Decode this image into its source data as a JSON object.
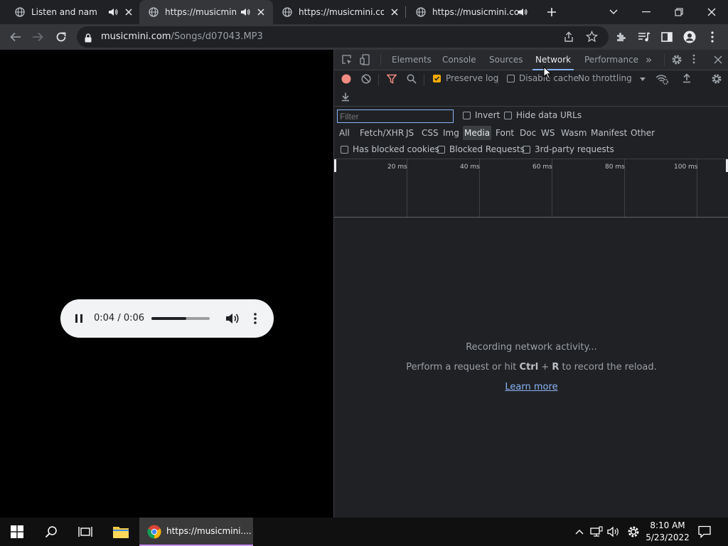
{
  "browser": {
    "tabs": [
      {
        "title": "Listen and name th",
        "audio": true
      },
      {
        "title": "https://musicmini.c",
        "audio": true
      },
      {
        "title": "https://musicmini.com/",
        "audio": false
      },
      {
        "title": "https://musicmini.com/",
        "audio": true
      }
    ],
    "new_tab_label": "+",
    "url_host": "musicmini.com",
    "url_path": "/Songs/d07043.MP3"
  },
  "player": {
    "time_display": "0:04 / 0:06",
    "progress_fraction": 0.6
  },
  "devtools": {
    "tabs": [
      "Elements",
      "Console",
      "Sources",
      "Network",
      "Performance"
    ],
    "active_tab": "Network",
    "more_tabs": "»",
    "toolbar": {
      "preserve_log": "Preserve log",
      "preserve_log_checked": true,
      "disable_cache": "Disable cache",
      "disable_cache_checked": false,
      "throttling": "No throttling"
    },
    "filter": {
      "placeholder": "Filter",
      "invert": "Invert",
      "hide_data_urls": "Hide data URLs",
      "types": [
        "All",
        "Fetch/XHR",
        "JS",
        "CSS",
        "Img",
        "Media",
        "Font",
        "Doc",
        "WS",
        "Wasm",
        "Manifest",
        "Other"
      ],
      "selected_type": "Media",
      "has_blocked_cookies": "Has blocked cookies",
      "blocked_requests": "Blocked Requests",
      "third_party": "3rd-party requests"
    },
    "timeline_ticks": [
      "20 ms",
      "40 ms",
      "60 ms",
      "80 ms",
      "100 ms"
    ],
    "empty_state": {
      "line1": "Recording network activity...",
      "line2_prefix": "Perform a request or hit ",
      "line2_key1": "Ctrl",
      "line2_plus": " + ",
      "line2_key2": "R",
      "line2_suffix": " to record the reload.",
      "learn_more": "Learn more"
    }
  },
  "taskbar": {
    "chrome_title": "https://musicmini....",
    "time": "8:10 AM",
    "date": "5/23/2022"
  },
  "colors": {
    "accent_blue": "#8ab4f8",
    "checkbox_orange": "#f9ab00",
    "record_red": "#f28b82"
  }
}
